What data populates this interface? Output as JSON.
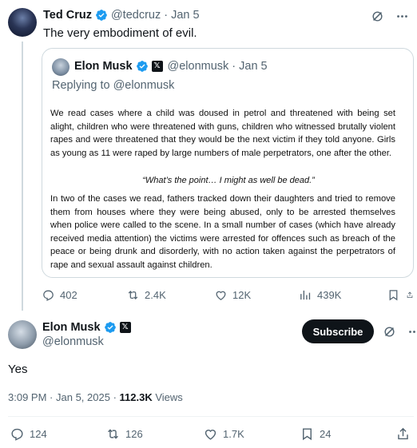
{
  "parent_tweet": {
    "author_name": "Ted Cruz",
    "handle": "@tedcruz",
    "date": "Jan 5",
    "text": "The very embodiment of evil."
  },
  "quote": {
    "author_name": "Elon Musk",
    "handle": "@elonmusk",
    "date": "Jan 5",
    "replying_to": "Replying to @elonmusk",
    "paragraph1": "We read cases where a child was doused in petrol and threatened with being set alight, children who were threatened with guns, children who witnessed brutally violent rapes and were threatened that they would be the next victim if they told anyone.  Girls as young as 11 were raped by large numbers of male perpetrators, one after the other.",
    "pull_quote": "“What’s the point… I might as well be dead.”",
    "paragraph2": "In two of the cases we read, fathers tracked down their daughters and tried to remove them from houses where they were being abused, only to be arrested themselves when police were called to the scene.  In a small number of cases (which have already received media attention) the victims were arrested for offences such as breach of the peace or being drunk and disorderly, with no action taken against the perpetrators of rape and sexual assault against children."
  },
  "quote_actions": {
    "replies": "402",
    "reposts": "2.4K",
    "likes": "12K",
    "views": "439K"
  },
  "main_tweet": {
    "author_name": "Elon Musk",
    "handle": "@elonmusk",
    "subscribe_label": "Subscribe",
    "text": "Yes",
    "time": "3:09 PM",
    "date": "Jan 5, 2025",
    "views_count": "112.3K",
    "views_label": "Views"
  },
  "main_actions": {
    "replies": "124",
    "reposts": "126",
    "likes": "1.7K",
    "bookmarks": "24"
  },
  "colors": {
    "verified": "#1d9bf0",
    "muted": "#536471",
    "border": "#cfd9de",
    "subscribe_bg": "#0f1419"
  },
  "icons": [
    "verified-badge-icon",
    "x-badge-icon",
    "grok-icon",
    "more-icon",
    "reply-icon",
    "repost-icon",
    "like-icon",
    "views-icon",
    "bookmark-icon",
    "share-icon"
  ]
}
